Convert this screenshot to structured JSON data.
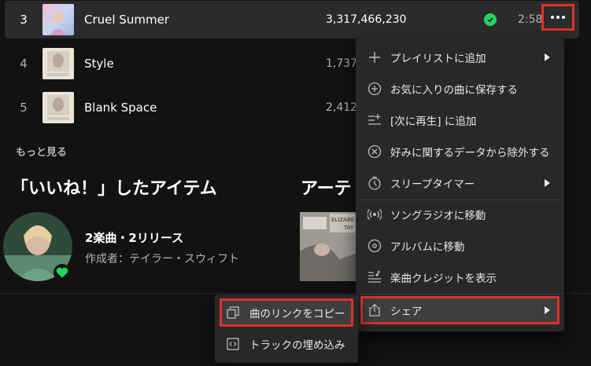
{
  "tracks": [
    {
      "number": "3",
      "title": "Cruel Summer",
      "plays": "3,317,466,230",
      "duration": "2:58"
    },
    {
      "number": "4",
      "title": "Style",
      "plays": "1,737"
    },
    {
      "number": "5",
      "title": "Blank Space",
      "plays": "2,412"
    }
  ],
  "sections": {
    "see_more": "もっと見る",
    "liked_heading": "「いいね！」したアイテム",
    "artist_heading": "アーテ"
  },
  "liked": {
    "count_label": "2楽曲・2リリース",
    "author_label": "作成者：テイラー・スウィフト"
  },
  "album_art_text": {
    "line1": "ELIZABE",
    "line2": "TAY"
  },
  "context_menu": {
    "items": [
      {
        "label": "プレイリストに追加",
        "icon": "plus-icon",
        "has_submenu": true
      },
      {
        "label": "お気に入りの曲に保存する",
        "icon": "plus-circle-icon",
        "has_submenu": false
      },
      {
        "label": "[次に再生] に追加",
        "icon": "add-to-queue-icon",
        "has_submenu": false
      },
      {
        "label": "好みに関するデータから除外する",
        "icon": "exclude-circle-icon",
        "has_submenu": false
      },
      {
        "label": "スリープタイマー",
        "icon": "timer-icon",
        "has_submenu": true
      },
      {
        "label": "ソングラジオに移動",
        "icon": "radio-icon",
        "has_submenu": false
      },
      {
        "label": "アルバムに移動",
        "icon": "album-icon",
        "has_submenu": false
      },
      {
        "label": "楽曲クレジットを表示",
        "icon": "credits-icon",
        "has_submenu": false
      },
      {
        "label": "シェア",
        "icon": "share-icon",
        "has_submenu": true
      }
    ]
  },
  "share_submenu": {
    "items": [
      {
        "label": "曲のリンクをコピー",
        "icon": "copy-link-icon"
      },
      {
        "label": "トラックの埋め込み",
        "icon": "embed-icon"
      }
    ]
  },
  "colors": {
    "background": "#121212",
    "highlight_row": "#2b2b2b",
    "menu": "#282828",
    "accent_green": "#1ed760",
    "annotation_red": "#e0302a"
  }
}
